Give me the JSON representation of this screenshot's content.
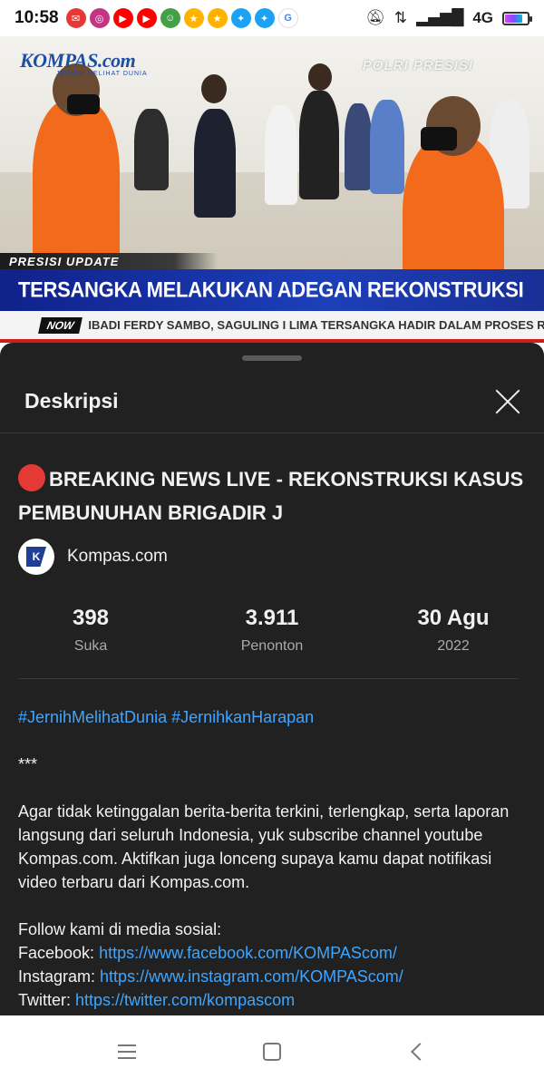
{
  "status_bar": {
    "time": "10:58",
    "network": "4G",
    "notif_icons": [
      {
        "name": "app-icon",
        "color": "#e53935",
        "glyph": "✉"
      },
      {
        "name": "instagram-icon",
        "color": "#c13584",
        "glyph": "◎"
      },
      {
        "name": "youtube-icon",
        "color": "#ff0000",
        "glyph": "▶"
      },
      {
        "name": "youtube-icon",
        "color": "#ff0000",
        "glyph": "▶"
      },
      {
        "name": "app-icon",
        "color": "#43a047",
        "glyph": "☺"
      },
      {
        "name": "app-icon",
        "color": "#ffb300",
        "glyph": "★"
      },
      {
        "name": "app-icon",
        "color": "#ffb300",
        "glyph": "★"
      },
      {
        "name": "twitter-icon",
        "color": "#1da1f2",
        "glyph": "✦"
      },
      {
        "name": "twitter-icon",
        "color": "#1da1f2",
        "glyph": "✦"
      },
      {
        "name": "google-icon",
        "color": "#ffffff",
        "glyph": "G"
      }
    ]
  },
  "video": {
    "brand": "KOMPAS.com",
    "brand_sub": "JERNIH MELIHAT DUNIA",
    "watermark": "POLRI PRESISI",
    "update_tag": "PRESISI UPDATE",
    "headline": "TERSANGKA MELAKUKAN ADEGAN REKONSTRUKSI",
    "now_badge": "NOW",
    "ticker": "IBADI FERDY SAMBO, SAGULING I  LIMA TERSANGKA HADIR DALAM PROSES REKONST"
  },
  "panel": {
    "title": "Deskripsi",
    "video_title": "BREAKING NEWS LIVE - REKONSTRUKSI KASUS PEMBUNUHAN BRIGADIR J",
    "channel": "Kompas.com",
    "channel_logo_letter": "K",
    "stats": [
      {
        "value": "398",
        "label": "Suka"
      },
      {
        "value": "3.911",
        "label": "Penonton"
      },
      {
        "value": "30 Agu",
        "label": "2022"
      }
    ],
    "hashtags": "#JernihMelihatDunia #JernihkanHarapan",
    "separator": "***",
    "body": "Agar tidak ketinggalan berita-berita terkini, terlengkap, serta laporan langsung dari seluruh Indonesia, yuk subscribe channel youtube Kompas.com. Aktifkan juga lonceng supaya kamu dapat notifikasi video terbaru dari Kompas.com.",
    "follow_intro": "Follow kami di media sosial:",
    "socials": [
      {
        "label": "Facebook: ",
        "url": "https://www.facebook.com/KOMPAScom/"
      },
      {
        "label": "Instagram: ",
        "url": "https://www.instagram.com/KOMPAScom/"
      },
      {
        "label": "Twitter: ",
        "url": "https://twitter.com/kompascom"
      }
    ]
  }
}
